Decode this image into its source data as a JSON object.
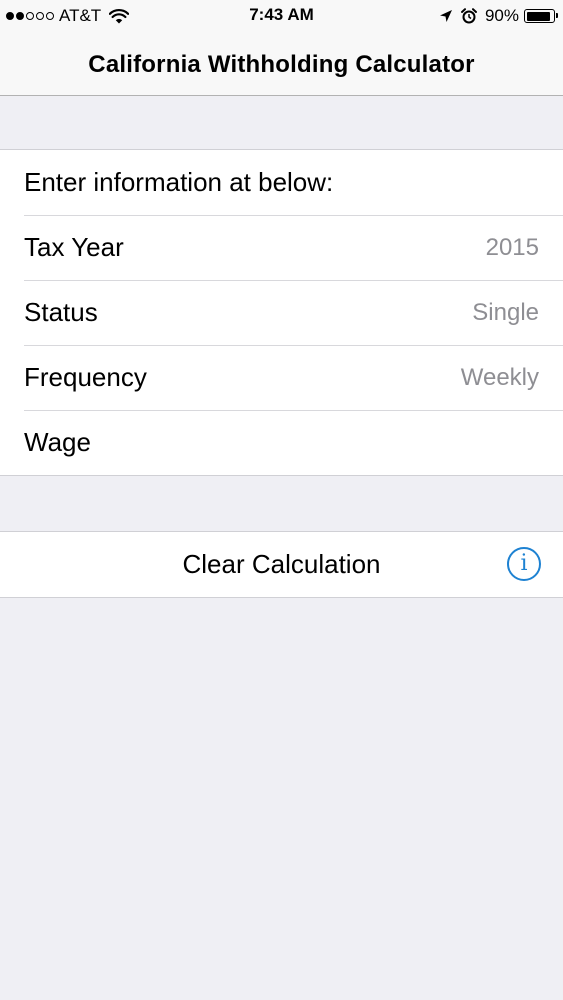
{
  "status_bar": {
    "carrier": "AT&T",
    "signal_bars_filled": 2,
    "signal_bars_total": 5,
    "time": "7:43 AM",
    "battery_percent": "90%",
    "battery_level": 0.9,
    "icons": [
      "signal-dots-icon",
      "wifi-icon",
      "location-arrow-icon",
      "alarm-clock-icon",
      "battery-icon"
    ]
  },
  "nav": {
    "title": "California Withholding Calculator"
  },
  "form": {
    "header": "Enter information at below:",
    "rows": [
      {
        "label": "Tax Year",
        "value": "2015"
      },
      {
        "label": "Status",
        "value": "Single"
      },
      {
        "label": "Frequency",
        "value": "Weekly"
      },
      {
        "label": "Wage",
        "value": ""
      }
    ]
  },
  "actions": {
    "clear_label": "Clear Calculation",
    "info_glyph": "i"
  },
  "colors": {
    "accent": "#1e82d2",
    "background": "#efeff4",
    "secondary_text": "#8e8e93"
  }
}
